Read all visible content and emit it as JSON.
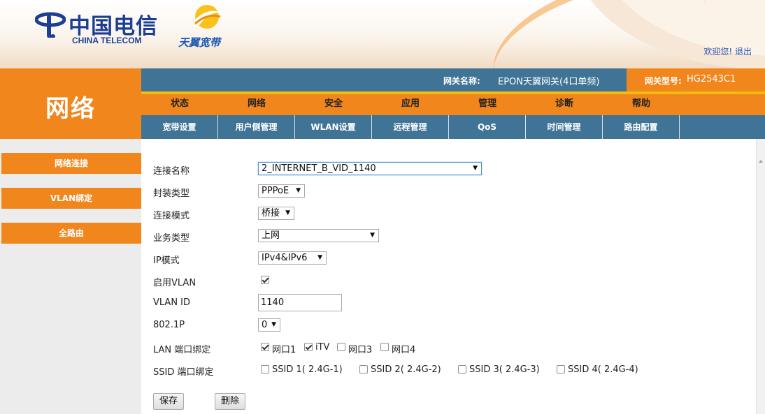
{
  "header": {
    "brand_cn": "中国电信",
    "brand_en": "CHINA TELECOM",
    "sub_brand": "天翼宽带",
    "welcome": "欢迎您!",
    "logout": "退出"
  },
  "section_title": "网络",
  "infobar": {
    "gateway_name_label": "网关名称:",
    "gateway_name": "EPON天翼网关(4口单频)",
    "gateway_model_label": "网关型号:",
    "gateway_model": "HG2543C1"
  },
  "main_menu": [
    "状态",
    "网络",
    "安全",
    "应用",
    "管理",
    "诊断",
    "帮助"
  ],
  "sub_menu": [
    "宽带设置",
    "用户侧管理",
    "WLAN设置",
    "远程管理",
    "QoS",
    "时间管理",
    "路由配置"
  ],
  "sidebar": [
    "网络连接",
    "VLAN绑定",
    "全路由"
  ],
  "form": {
    "connection_name_label": "连接名称",
    "connection_name_value": "2_INTERNET_B_VID_1140",
    "encap_label": "封装类型",
    "encap_value": "PPPoE",
    "mode_label": "连接模式",
    "mode_value": "桥接",
    "service_label": "业务类型",
    "service_value": "上网",
    "ip_mode_label": "IP模式",
    "ip_mode_value": "IPv4&IPv6",
    "vlan_enable_label": "启用VLAN",
    "vlan_enable_checked": true,
    "vlan_id_label": "VLAN ID",
    "vlan_id_value": "1140",
    "dot1p_label": "802.1P",
    "dot1p_value": "0",
    "lan_bind_label": "LAN 端口绑定",
    "lan_ports": [
      {
        "label": "网口1",
        "checked": true
      },
      {
        "label": "iTV",
        "checked": true
      },
      {
        "label": "网口3",
        "checked": false
      },
      {
        "label": "网口4",
        "checked": false
      }
    ],
    "ssid_bind_label": "SSID 端口绑定",
    "ssids": [
      {
        "label": "SSID 1( 2.4G-1)",
        "checked": false
      },
      {
        "label": "SSID 2( 2.4G-2)",
        "checked": false
      },
      {
        "label": "SSID 3( 2.4G-3)",
        "checked": false
      },
      {
        "label": "SSID 4( 2.4G-4)",
        "checked": false
      }
    ],
    "save_label": "保存",
    "delete_label": "删除"
  },
  "colors": {
    "orange": "#f0861c",
    "steel_blue": "#3f7496",
    "yellow_strip": "#f6bb12",
    "brand_blue": "#1c3f94"
  }
}
